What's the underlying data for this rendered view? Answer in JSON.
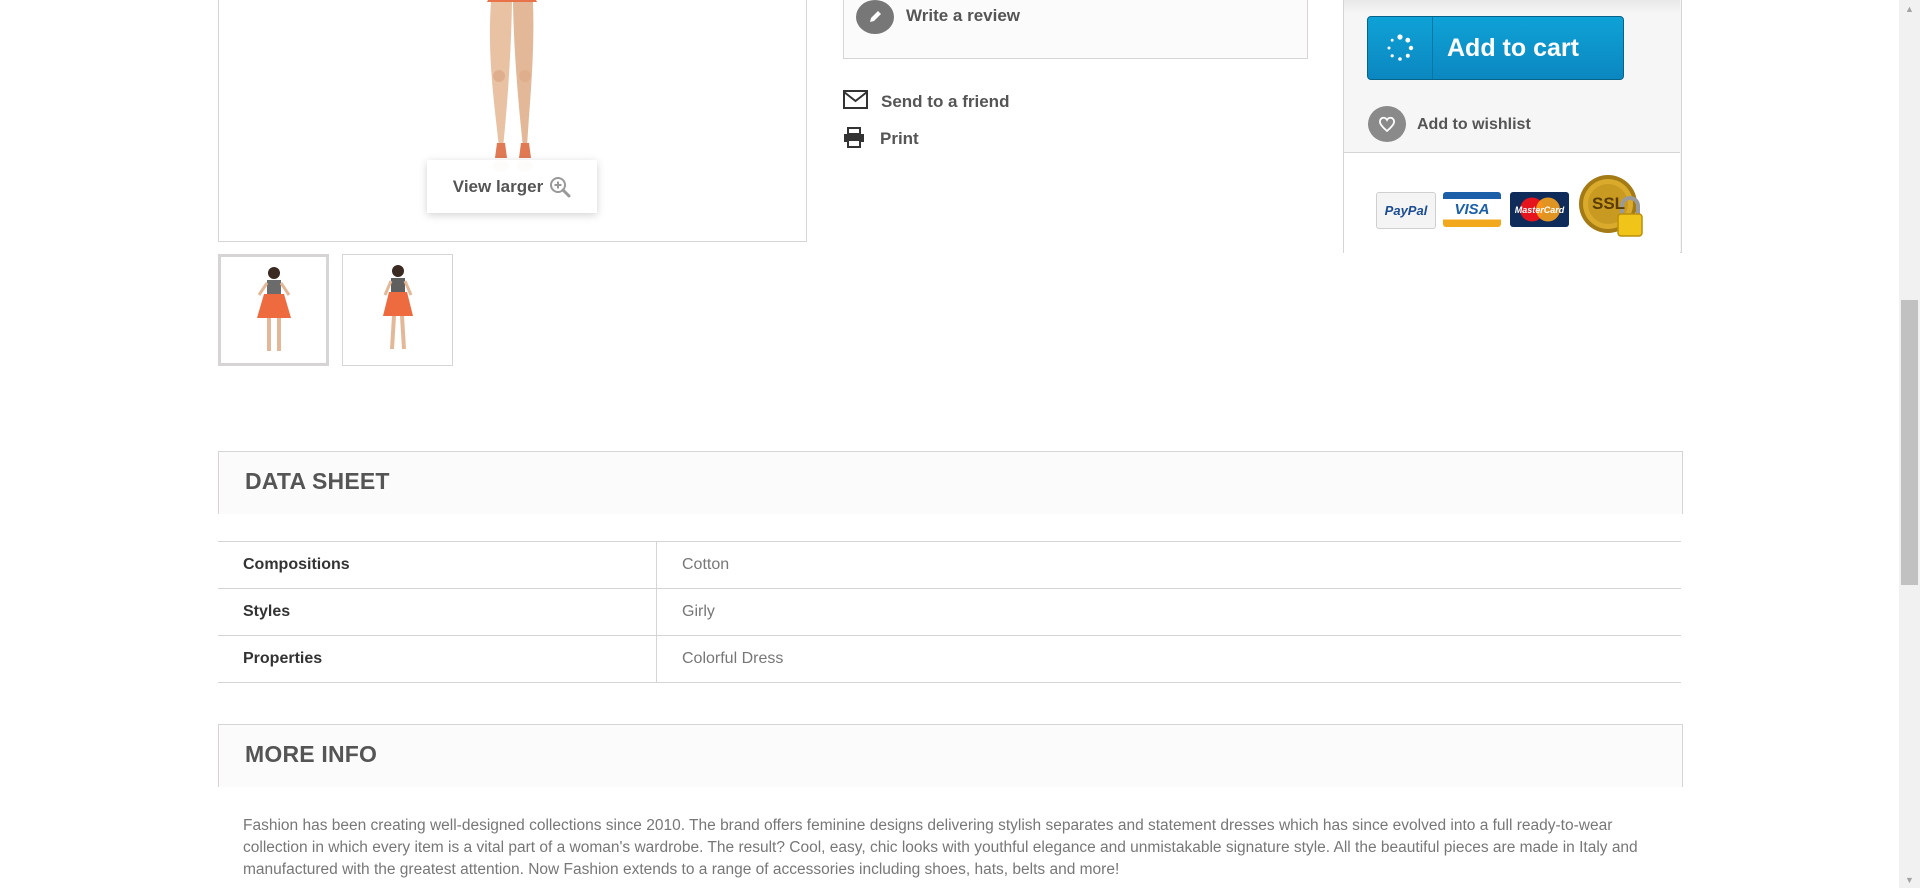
{
  "image": {
    "view_larger": "View larger"
  },
  "actions": {
    "write_review": "Write a review",
    "send_to_friend": "Send to a friend",
    "print": "Print"
  },
  "cart": {
    "add_to_cart": "Add to cart",
    "add_to_wishlist": "Add to wishlist",
    "accent": "#0c8fc9",
    "payment_logos": [
      "PayPal",
      "VISA",
      "MasterCard",
      "SSL"
    ]
  },
  "data_sheet": {
    "title": "DATA SHEET",
    "rows": [
      {
        "label": "Compositions",
        "value": "Cotton"
      },
      {
        "label": "Styles",
        "value": "Girly"
      },
      {
        "label": "Properties",
        "value": "Colorful Dress"
      }
    ]
  },
  "more_info": {
    "title": "MORE INFO",
    "text": "Fashion has been creating well-designed collections since 2010. The brand offers feminine designs delivering stylish separates and statement dresses which has since evolved into a full ready-to-wear collection in which every item is a vital part of a woman's wardrobe. The result? Cool, easy, chic looks with youthful elegance and unmistakable signature style. All the beautiful pieces are made in Italy and manufactured with the greatest attention. Now Fashion extends to a range of accessories including shoes, hats, belts and more!"
  }
}
